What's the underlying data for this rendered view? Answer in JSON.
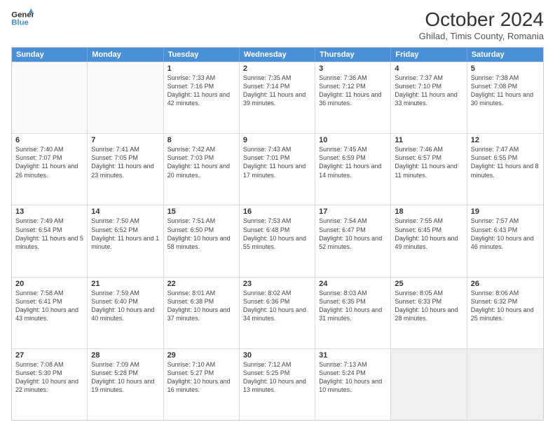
{
  "header": {
    "logo_line1": "General",
    "logo_line2": "Blue",
    "month": "October 2024",
    "location": "Ghilad, Timis County, Romania"
  },
  "weekdays": [
    "Sunday",
    "Monday",
    "Tuesday",
    "Wednesday",
    "Thursday",
    "Friday",
    "Saturday"
  ],
  "rows": [
    [
      {
        "day": "",
        "text": ""
      },
      {
        "day": "",
        "text": ""
      },
      {
        "day": "1",
        "text": "Sunrise: 7:33 AM\nSunset: 7:16 PM\nDaylight: 11 hours and 42 minutes."
      },
      {
        "day": "2",
        "text": "Sunrise: 7:35 AM\nSunset: 7:14 PM\nDaylight: 11 hours and 39 minutes."
      },
      {
        "day": "3",
        "text": "Sunrise: 7:36 AM\nSunset: 7:12 PM\nDaylight: 11 hours and 36 minutes."
      },
      {
        "day": "4",
        "text": "Sunrise: 7:37 AM\nSunset: 7:10 PM\nDaylight: 11 hours and 33 minutes."
      },
      {
        "day": "5",
        "text": "Sunrise: 7:38 AM\nSunset: 7:08 PM\nDaylight: 11 hours and 30 minutes."
      }
    ],
    [
      {
        "day": "6",
        "text": "Sunrise: 7:40 AM\nSunset: 7:07 PM\nDaylight: 11 hours and 26 minutes."
      },
      {
        "day": "7",
        "text": "Sunrise: 7:41 AM\nSunset: 7:05 PM\nDaylight: 11 hours and 23 minutes."
      },
      {
        "day": "8",
        "text": "Sunrise: 7:42 AM\nSunset: 7:03 PM\nDaylight: 11 hours and 20 minutes."
      },
      {
        "day": "9",
        "text": "Sunrise: 7:43 AM\nSunset: 7:01 PM\nDaylight: 11 hours and 17 minutes."
      },
      {
        "day": "10",
        "text": "Sunrise: 7:45 AM\nSunset: 6:59 PM\nDaylight: 11 hours and 14 minutes."
      },
      {
        "day": "11",
        "text": "Sunrise: 7:46 AM\nSunset: 6:57 PM\nDaylight: 11 hours and 11 minutes."
      },
      {
        "day": "12",
        "text": "Sunrise: 7:47 AM\nSunset: 6:55 PM\nDaylight: 11 hours and 8 minutes."
      }
    ],
    [
      {
        "day": "13",
        "text": "Sunrise: 7:49 AM\nSunset: 6:54 PM\nDaylight: 11 hours and 5 minutes."
      },
      {
        "day": "14",
        "text": "Sunrise: 7:50 AM\nSunset: 6:52 PM\nDaylight: 11 hours and 1 minute."
      },
      {
        "day": "15",
        "text": "Sunrise: 7:51 AM\nSunset: 6:50 PM\nDaylight: 10 hours and 58 minutes."
      },
      {
        "day": "16",
        "text": "Sunrise: 7:53 AM\nSunset: 6:48 PM\nDaylight: 10 hours and 55 minutes."
      },
      {
        "day": "17",
        "text": "Sunrise: 7:54 AM\nSunset: 6:47 PM\nDaylight: 10 hours and 52 minutes."
      },
      {
        "day": "18",
        "text": "Sunrise: 7:55 AM\nSunset: 6:45 PM\nDaylight: 10 hours and 49 minutes."
      },
      {
        "day": "19",
        "text": "Sunrise: 7:57 AM\nSunset: 6:43 PM\nDaylight: 10 hours and 46 minutes."
      }
    ],
    [
      {
        "day": "20",
        "text": "Sunrise: 7:58 AM\nSunset: 6:41 PM\nDaylight: 10 hours and 43 minutes."
      },
      {
        "day": "21",
        "text": "Sunrise: 7:59 AM\nSunset: 6:40 PM\nDaylight: 10 hours and 40 minutes."
      },
      {
        "day": "22",
        "text": "Sunrise: 8:01 AM\nSunset: 6:38 PM\nDaylight: 10 hours and 37 minutes."
      },
      {
        "day": "23",
        "text": "Sunrise: 8:02 AM\nSunset: 6:36 PM\nDaylight: 10 hours and 34 minutes."
      },
      {
        "day": "24",
        "text": "Sunrise: 8:03 AM\nSunset: 6:35 PM\nDaylight: 10 hours and 31 minutes."
      },
      {
        "day": "25",
        "text": "Sunrise: 8:05 AM\nSunset: 6:33 PM\nDaylight: 10 hours and 28 minutes."
      },
      {
        "day": "26",
        "text": "Sunrise: 8:06 AM\nSunset: 6:32 PM\nDaylight: 10 hours and 25 minutes."
      }
    ],
    [
      {
        "day": "27",
        "text": "Sunrise: 7:08 AM\nSunset: 5:30 PM\nDaylight: 10 hours and 22 minutes."
      },
      {
        "day": "28",
        "text": "Sunrise: 7:09 AM\nSunset: 5:28 PM\nDaylight: 10 hours and 19 minutes."
      },
      {
        "day": "29",
        "text": "Sunrise: 7:10 AM\nSunset: 5:27 PM\nDaylight: 10 hours and 16 minutes."
      },
      {
        "day": "30",
        "text": "Sunrise: 7:12 AM\nSunset: 5:25 PM\nDaylight: 10 hours and 13 minutes."
      },
      {
        "day": "31",
        "text": "Sunrise: 7:13 AM\nSunset: 5:24 PM\nDaylight: 10 hours and 10 minutes."
      },
      {
        "day": "",
        "text": ""
      },
      {
        "day": "",
        "text": ""
      }
    ]
  ]
}
